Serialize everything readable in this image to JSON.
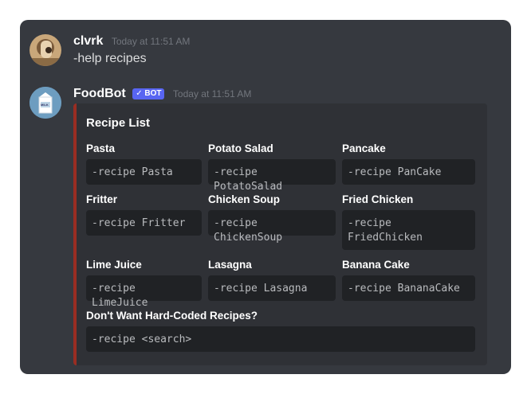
{
  "messages": [
    {
      "username": "clvrk",
      "timestamp": "Today at 11:51 AM",
      "text": "-help recipes"
    },
    {
      "username": "FoodBot",
      "bot_tag": "✓ BOT",
      "timestamp": "Today at 11:51 AM",
      "avatar_label": "MILK"
    }
  ],
  "embed": {
    "accent_color": "#992d22",
    "title": "Recipe List",
    "fields": [
      {
        "name": "Pasta",
        "value": "-recipe Pasta"
      },
      {
        "name": "Potato Salad",
        "value": "-recipe PotatoSalad"
      },
      {
        "name": "Pancake",
        "value": "-recipe PanCake"
      },
      {
        "name": "Fritter",
        "value": "-recipe Fritter"
      },
      {
        "name": "Chicken Soup",
        "value": "-recipe ChickenSoup"
      },
      {
        "name": "Fried Chicken",
        "value": "-recipe FriedChicken"
      },
      {
        "name": "Lime Juice",
        "value": "-recipe LimeJuice"
      },
      {
        "name": "Lasagna",
        "value": "-recipe Lasagna"
      },
      {
        "name": "Banana Cake",
        "value": "-recipe BananaCake"
      },
      {
        "name": "Don't Want Hard-Coded Recipes?",
        "value": "-recipe <search>"
      }
    ]
  }
}
